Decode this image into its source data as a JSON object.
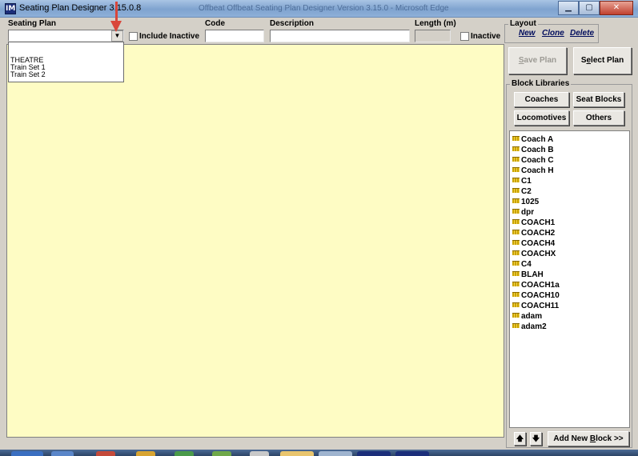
{
  "window": {
    "title": "Seating Plan Designer  3.15.0.8",
    "title_center": "Offbeat Offbeat Seating Plan Designer Version 3.15.0 - Microsoft Edge",
    "controls": {
      "minimize": "▁",
      "maximize": "▢",
      "close": "✕"
    },
    "app_icon": "IM"
  },
  "toolbar": {
    "seating_plan_label": "Seating Plan",
    "seating_plan_value": "",
    "include_inactive_label": "Include Inactive",
    "code_label": "Code",
    "code_value": "",
    "description_label": "Description",
    "description_value": "",
    "length_label": "Length (m)",
    "length_value": "",
    "inactive_label": "Inactive"
  },
  "dropdown": {
    "options": [
      "",
      "",
      "THEATRE",
      "Train Set 1",
      "Train Set 2"
    ]
  },
  "layout": {
    "title": "Layout",
    "new_label": "New",
    "clone_label": "Clone",
    "delete_label": "Delete"
  },
  "actions": {
    "save_plan": {
      "prefix": "",
      "underlined": "S",
      "rest": "ave Plan"
    },
    "select_plan": {
      "prefix": "S",
      "underlined": "e",
      "rest": "lect Plan"
    }
  },
  "block_libraries": {
    "title": "Block Libraries",
    "buttons": [
      "Coaches",
      "Seat Blocks",
      "Locomotives",
      "Others"
    ],
    "items": [
      "Coach A",
      "Coach B",
      "Coach C",
      "Coach H",
      "C1",
      "C2",
      "1025",
      "dpr",
      "COACH1",
      "COACH2",
      "COACH4",
      "COACHX",
      "C4",
      "BLAH",
      "COACH1a",
      "COACH10",
      "COACH11",
      "adam",
      "adam2"
    ],
    "up_icon": "🡅",
    "down_icon": "🡇",
    "add_new_block": {
      "prefix": "Add New ",
      "underlined": "B",
      "rest": "lock >>"
    }
  },
  "colors": {
    "canvas": "#fefcc4",
    "arrow": "#d9463a",
    "window_bg": "#d4d0c8"
  }
}
